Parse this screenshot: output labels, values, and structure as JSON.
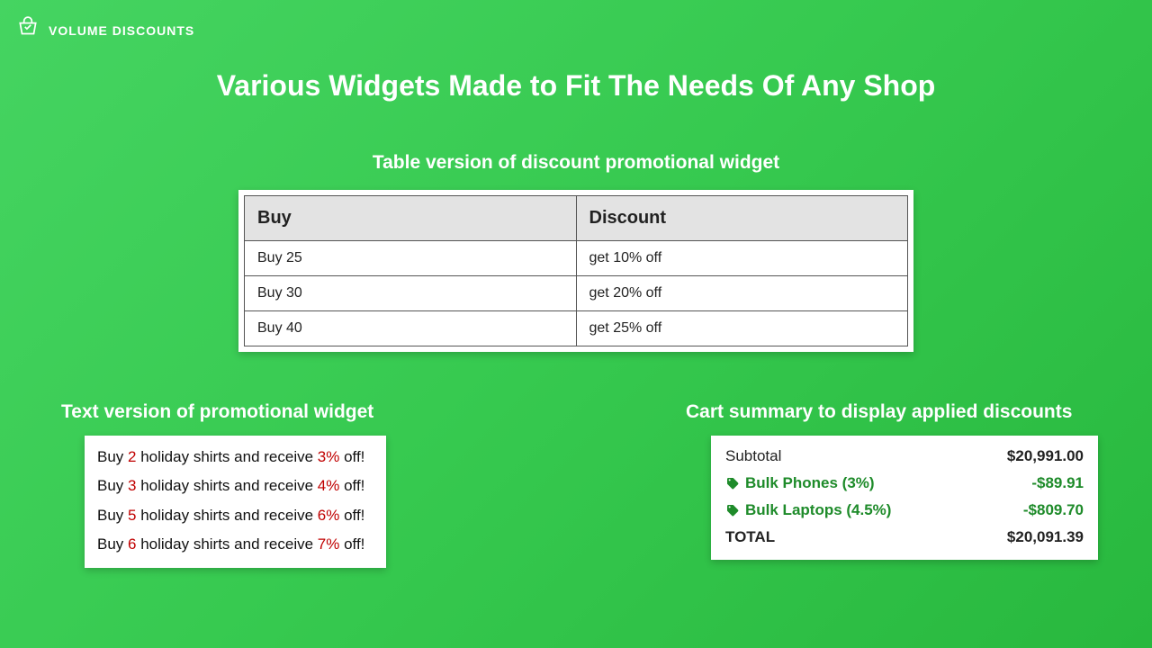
{
  "brand": {
    "name": "VOLUME DISCOUNTS"
  },
  "main_title": "Various Widgets Made to Fit The Needs Of Any Shop",
  "table_section": {
    "title": "Table version of discount promotional widget",
    "head": {
      "buy": "Buy",
      "discount": "Discount"
    },
    "rows": [
      {
        "buy": "Buy 25",
        "discount": "get 10% off"
      },
      {
        "buy": "Buy 30",
        "discount": "get 20% off"
      },
      {
        "buy": "Buy 40",
        "discount": "get 25% off"
      }
    ]
  },
  "text_section": {
    "title": "Text version of promotional widget",
    "lines": [
      {
        "pre": "Buy ",
        "qty": "2",
        "mid": " holiday shirts and receive ",
        "pct": "3%",
        "post": " off!"
      },
      {
        "pre": "Buy ",
        "qty": "3",
        "mid": " holiday shirts and receive ",
        "pct": "4%",
        "post": " off!"
      },
      {
        "pre": "Buy ",
        "qty": "5",
        "mid": " holiday shirts and receive ",
        "pct": "6%",
        "post": " off!"
      },
      {
        "pre": "Buy ",
        "qty": "6",
        "mid": " holiday shirts and receive ",
        "pct": "7%",
        "post": " off!"
      }
    ]
  },
  "cart_section": {
    "title": "Cart summary to display applied discounts",
    "subtotal": {
      "label": "Subtotal",
      "amount": "$20,991.00"
    },
    "discounts": [
      {
        "label": "Bulk Phones (3%)",
        "amount": "-$89.91"
      },
      {
        "label": "Bulk Laptops (4.5%)",
        "amount": "-$809.70"
      }
    ],
    "total": {
      "label": "TOTAL",
      "amount": "$20,091.39"
    }
  }
}
